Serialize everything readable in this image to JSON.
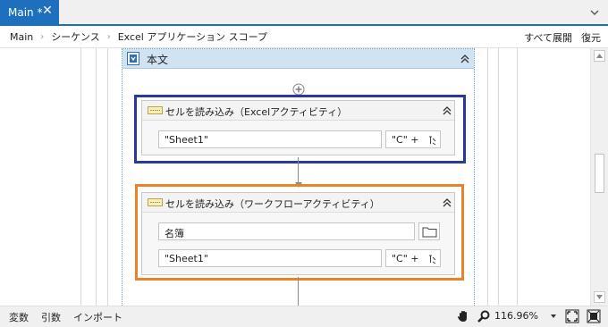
{
  "tabs": [
    {
      "label": "Main *",
      "active": true
    }
  ],
  "breadcrumb": [
    "Main",
    "シーケンス",
    "Excel アプリケーション スコープ"
  ],
  "toolbar": {
    "expand_all": "すべて展開",
    "restore": "復元"
  },
  "scope": {
    "title": "本文"
  },
  "activity1": {
    "title": "セルを読み込み（Excelアクティビティ）",
    "sheet": "\"Sheet1\"",
    "cell": "\"C\" +",
    "highlight_color": "#2a3a9a"
  },
  "activity2": {
    "title": "セルを読み込み（ワークフローアクティビティ）",
    "workbook": "名簿",
    "sheet": "\"Sheet1\"",
    "cell": "\"C\" +",
    "highlight_color": "#e8832a"
  },
  "statusbar": {
    "items": [
      "変数",
      "引数",
      "インポート"
    ],
    "zoom": "116.96%"
  },
  "icons": {
    "close": "close-icon",
    "tab_menu": "chevron-down-icon",
    "collapse": "double-chevron-up-icon",
    "add": "add-circle-icon",
    "folder": "folder-icon",
    "hand": "hand-pan-icon",
    "search": "magnifier-icon",
    "fit": "fit-screen-icon",
    "overview": "overview-icon"
  },
  "colors": {
    "accent": "#1f6fbf",
    "scope_header": "#cfe3f3"
  }
}
